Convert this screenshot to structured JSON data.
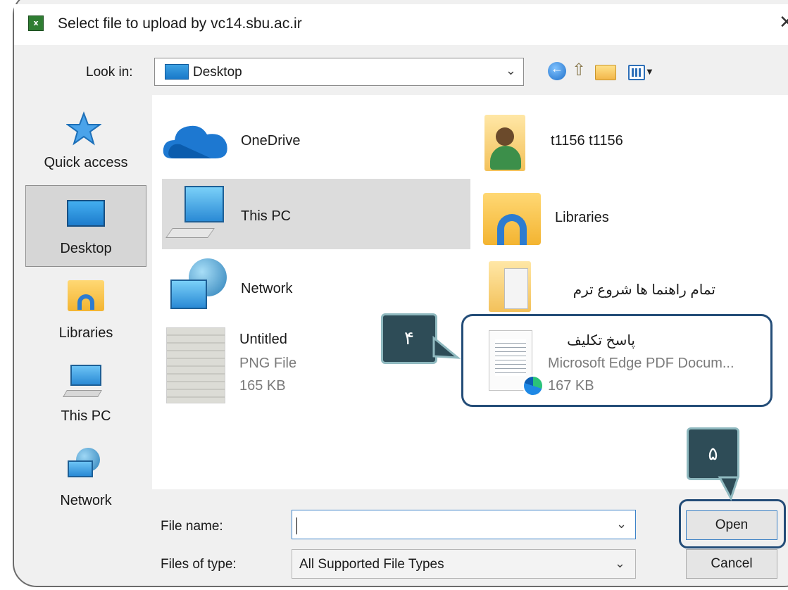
{
  "dialog": {
    "title": "Select file to upload by vc14.sbu.ac.ir",
    "app_icon_text": "x"
  },
  "toolbar": {
    "look_in_label": "Look in:",
    "look_in_value": "Desktop",
    "icons": [
      "back-icon",
      "up-folder-icon",
      "new-folder-icon",
      "view-menu-icon"
    ]
  },
  "places": {
    "items": [
      {
        "label": "Quick access",
        "icon": "star-icon"
      },
      {
        "label": "Desktop",
        "icon": "desktop-icon"
      },
      {
        "label": "Libraries",
        "icon": "libraries-icon"
      },
      {
        "label": "This PC",
        "icon": "computer-icon"
      },
      {
        "label": "Network",
        "icon": "network-icon"
      }
    ]
  },
  "files": {
    "onedrive": {
      "name": "OneDrive",
      "icon": "cloud-icon"
    },
    "user": {
      "name": "t1156 t1156",
      "icon": "user-folder-icon"
    },
    "thispc": {
      "name": "This PC",
      "icon": "computer-icon"
    },
    "libraries": {
      "name": "Libraries",
      "icon": "libraries-icon"
    },
    "network": {
      "name": "Network",
      "icon": "network-icon"
    },
    "guide": {
      "name": "تمام راهنما ها شروع ترم",
      "icon": "folder-icon"
    },
    "untitled": {
      "name": "Untitled",
      "type": "PNG File",
      "size": "165 KB",
      "icon": "png-thumbnail-icon"
    },
    "answer": {
      "name": "پاسخ تکلیف",
      "type": "Microsoft Edge PDF Docum...",
      "size": "167 KB",
      "icon": "pdf-thumbnail-icon"
    }
  },
  "bottom": {
    "file_name_label": "File name:",
    "file_name_value": "",
    "files_of_type_label": "Files of type:",
    "files_of_type_value": "All Supported File Types",
    "open_label": "Open",
    "cancel_label": "Cancel"
  },
  "annotations": {
    "callout_4": "۴",
    "callout_5": "۵"
  },
  "colors": {
    "highlight_border": "#244d78",
    "callout_fill": "#2e4c57",
    "callout_border": "#8fb9bf",
    "selection": "#dcdcdc"
  }
}
